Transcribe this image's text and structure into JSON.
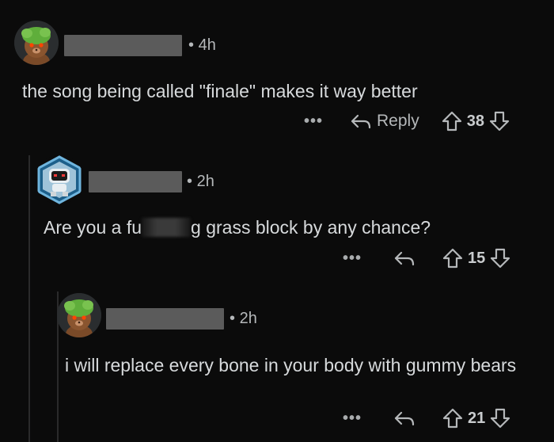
{
  "comments": [
    {
      "time": "4h",
      "text": "the song being called \"finale\" makes it way better",
      "more": "•••",
      "reply_label": "Reply",
      "votes": "38"
    },
    {
      "time": "2h",
      "text_before": "Are you a fu",
      "text_after": "g grass block by any chance?",
      "more": "•••",
      "votes": "15"
    },
    {
      "time": "2h",
      "text": "i will replace every bone in your body with gummy bears",
      "more": "•••",
      "votes": "21"
    }
  ],
  "separator": "•",
  "colors": {
    "background": "#0b0b0b",
    "text": "#d7dadc",
    "muted": "#b5b8ba",
    "redaction": "#5b5b5b"
  }
}
